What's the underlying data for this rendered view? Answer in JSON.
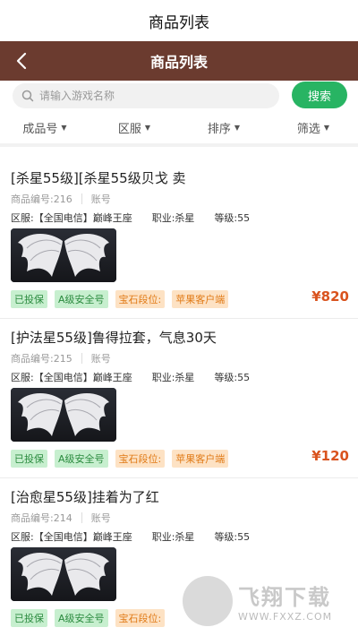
{
  "top_title": "商品列表",
  "appbar": {
    "title": "商品列表"
  },
  "search": {
    "placeholder": "请输入游戏名称",
    "button_label": "搜索"
  },
  "filters": [
    "成品号",
    "区服",
    "排序",
    "筛选"
  ],
  "products": [
    {
      "name": "[杀星55级][杀星55级贝戈 卖",
      "id_label": "商品编号:216",
      "account_label": "账号",
      "server": "区服:【全国电信】巅峰王座",
      "job": "职业:杀星",
      "level": "等级:55",
      "tags": [
        "已投保",
        "A级安全号",
        "宝石段位:",
        "苹果客户端"
      ],
      "price": "¥820"
    },
    {
      "name": "[护法星55级]鲁得拉套，气息30天",
      "id_label": "商品编号:215",
      "account_label": "账号",
      "server": "区服:【全国电信】巅峰王座",
      "job": "职业:杀星",
      "level": "等级:55",
      "tags": [
        "已投保",
        "A级安全号",
        "宝石段位:",
        "苹果客户端"
      ],
      "price": "¥120"
    },
    {
      "name": "[治愈星55级]挂着为了红",
      "id_label": "商品编号:214",
      "account_label": "账号",
      "server": "区服:【全国电信】巅峰王座",
      "job": "职业:杀星",
      "level": "等级:55",
      "tags": [
        "已投保",
        "A级安全号",
        "宝石段位:"
      ],
      "price": ""
    }
  ],
  "watermark": {
    "text": "飞翔下载",
    "url": "WWW.FXXZ.COM"
  },
  "colors": {
    "appbar": "#6b3b2f",
    "search_button": "#28b463",
    "price": "#d9531e",
    "tag_green": "#c7efcf",
    "tag_orange": "#fde2c4"
  }
}
